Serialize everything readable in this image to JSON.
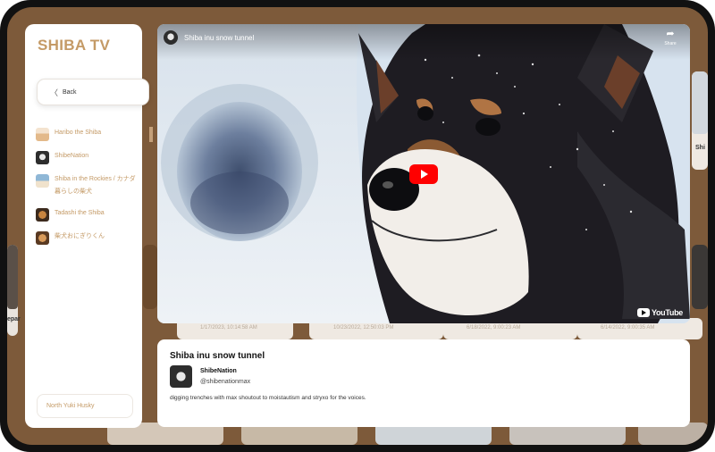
{
  "app": {
    "brand": "SHIBA TV"
  },
  "nav": {
    "back_label": "Back",
    "back_icon": "chevron-left-icon"
  },
  "channels": [
    {
      "label": "Haribo the Shiba",
      "active": true
    },
    {
      "label": "ShibeNation",
      "active": false
    },
    {
      "label": "Shiba in the Rockies / カナダ暮らしの柴犬",
      "active": false
    },
    {
      "label": "Tadashi the Shiba",
      "active": false
    },
    {
      "label": "柴犬おにぎりくん",
      "active": false
    }
  ],
  "footer": {
    "label": "North Yuki Husky"
  },
  "video": {
    "title": "Shiba inu snow tunnel",
    "share_label": "Share",
    "platform_label": "YouTube"
  },
  "info": {
    "title": "Shiba inu snow tunnel",
    "channel_name": "ShibeNation",
    "channel_handle": "@shibenationmax",
    "description": "digging trenches with max shoutout to moistautism and stryxo for the voices."
  },
  "background": {
    "dates": [
      "1/17/2023, 10:14:58 AM",
      "10/23/2022, 12:50:03 PM",
      "6/18/2022, 9:00:23 AM",
      "6/14/2022, 9:00:35 AM"
    ],
    "partial_title_left": "epar",
    "partial_title_right": "Shi"
  },
  "colors": {
    "accent": "#c49a66",
    "frame": "#7d5a3a",
    "play_button": "#ff0000"
  }
}
